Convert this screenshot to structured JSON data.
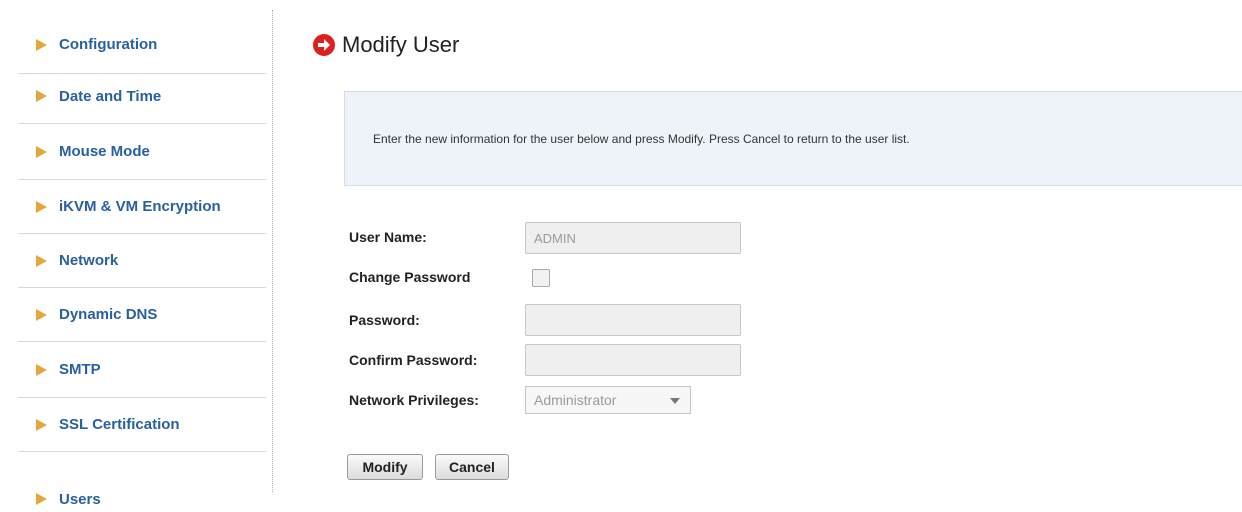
{
  "sidebar": {
    "items": [
      {
        "label": "Configuration"
      },
      {
        "label": "Date and Time"
      },
      {
        "label": "Mouse Mode"
      },
      {
        "label": "iKVM & VM Encryption"
      },
      {
        "label": "Network"
      },
      {
        "label": "Dynamic DNS"
      },
      {
        "label": "SMTP"
      },
      {
        "label": "SSL Certification"
      },
      {
        "label": "Users"
      }
    ]
  },
  "main": {
    "title": "Modify User",
    "info": "Enter the new information for the user below and press Modify. Press Cancel to return to the user list.",
    "form": {
      "user_name_label": "User Name:",
      "user_name_value": "ADMIN",
      "change_password_label": "Change Password",
      "change_password_checked": false,
      "password_label": "Password:",
      "password_value": "",
      "confirm_password_label": "Confirm Password:",
      "confirm_password_value": "",
      "network_privileges_label": "Network Privileges:",
      "network_privileges_value": "Administrator"
    },
    "buttons": {
      "modify": "Modify",
      "cancel": "Cancel"
    }
  },
  "colors": {
    "sidebar_link": "#29609f",
    "sidebar_arrow": "#e3a73c",
    "title_icon": "#d9211e",
    "info_box_bg": "#eef3fa"
  },
  "icons": {
    "sidebar_bullet": "right-triangle-icon",
    "title": "red-circle-arrow-icon"
  }
}
